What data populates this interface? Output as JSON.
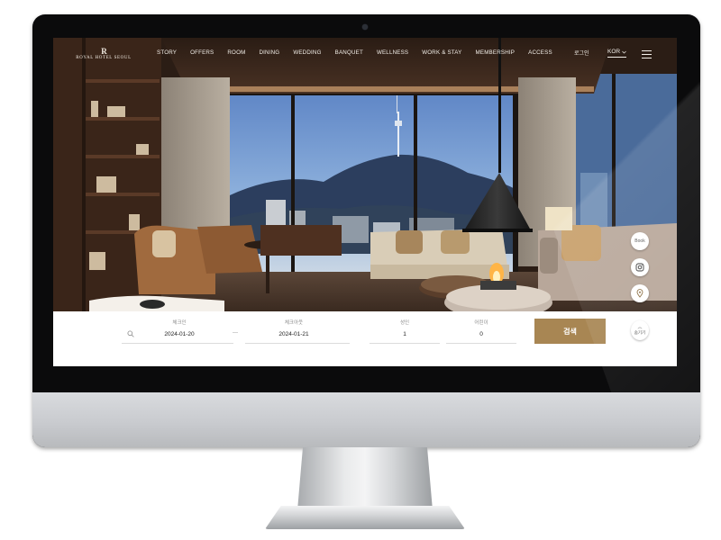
{
  "brand": {
    "logo_mark": "R",
    "logo_text": "ROYAL HOTEL SEOUL",
    "accent": "#a88653"
  },
  "nav": {
    "items": [
      "STORY",
      "OFFERS",
      "ROOM",
      "DINING",
      "WEDDING",
      "BANQUET",
      "WELLNESS",
      "WORK & STAY",
      "MEMBERSHIP",
      "ACCESS"
    ],
    "util_text": "로그인",
    "lang": "KOR",
    "lang_icon": "chevron-down-icon",
    "menu_icon": "hamburger-menu-icon"
  },
  "side_buttons": {
    "book_label": "Book",
    "instagram_icon": "instagram-icon",
    "map_icon": "map-pin-icon",
    "hide_label": "숨기기",
    "hide_icon": "chevron-up-icon"
  },
  "booking": {
    "checkin_label": "체크인",
    "checkin_value": "2024-01-20",
    "separator": "—",
    "checkout_label": "체크아웃",
    "checkout_value": "2024-01-21",
    "adults_label": "성인",
    "adults_value": "1",
    "children_label": "어린이",
    "children_value": "0",
    "search_label": "검색",
    "search_icon": "search-icon"
  }
}
